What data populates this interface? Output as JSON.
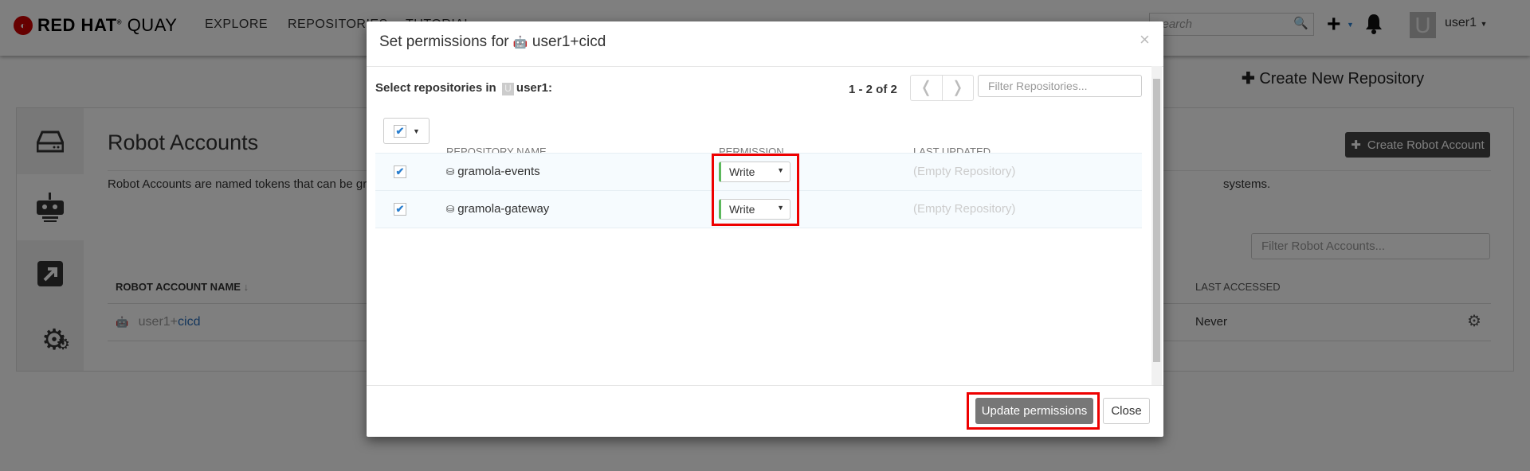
{
  "nav": {
    "brand": "RED HAT",
    "brand_product": "QUAY",
    "links": [
      "EXPLORE",
      "REPOSITORIES",
      "TUTORIAL"
    ],
    "search_placeholder": "search",
    "user": "user1",
    "avatar_letter": "U"
  },
  "page": {
    "create_repo": "Create New Repository",
    "title": "Robot Accounts",
    "create_robot": "Create Robot Account",
    "description_left": "Robot Accounts are named tokens that can be grante",
    "description_right": "systems.",
    "filter_placeholder": "Filter Robot Accounts...",
    "col_name": "ROBOT ACCOUNT NAME",
    "col_last_accessed": "LAST ACCESSED",
    "robots": [
      {
        "prefix": "user1+",
        "name": "cicd",
        "last_accessed": "Never"
      }
    ]
  },
  "modal": {
    "title_prefix": "Set permissions for",
    "robot": "user1+cicd",
    "select_label": "Select repositories in",
    "namespace": "user1",
    "namespace_letter": "U",
    "paging": "1 - 2 of 2",
    "filter_placeholder": "Filter Repositories...",
    "columns": [
      "REPOSITORY NAME",
      "PERMISSION",
      "LAST UPDATED"
    ],
    "rows": [
      {
        "name": "gramola-events",
        "permission": "Write",
        "last_updated": "(Empty Repository)",
        "checked": true
      },
      {
        "name": "gramola-gateway",
        "permission": "Write",
        "last_updated": "(Empty Repository)",
        "checked": true
      }
    ],
    "update_button": "Update permissions",
    "close_button": "Close"
  },
  "colors": {
    "accent": "#2a7fcf",
    "highlight": "#ee0000",
    "permission_write": "#5cb85c"
  }
}
